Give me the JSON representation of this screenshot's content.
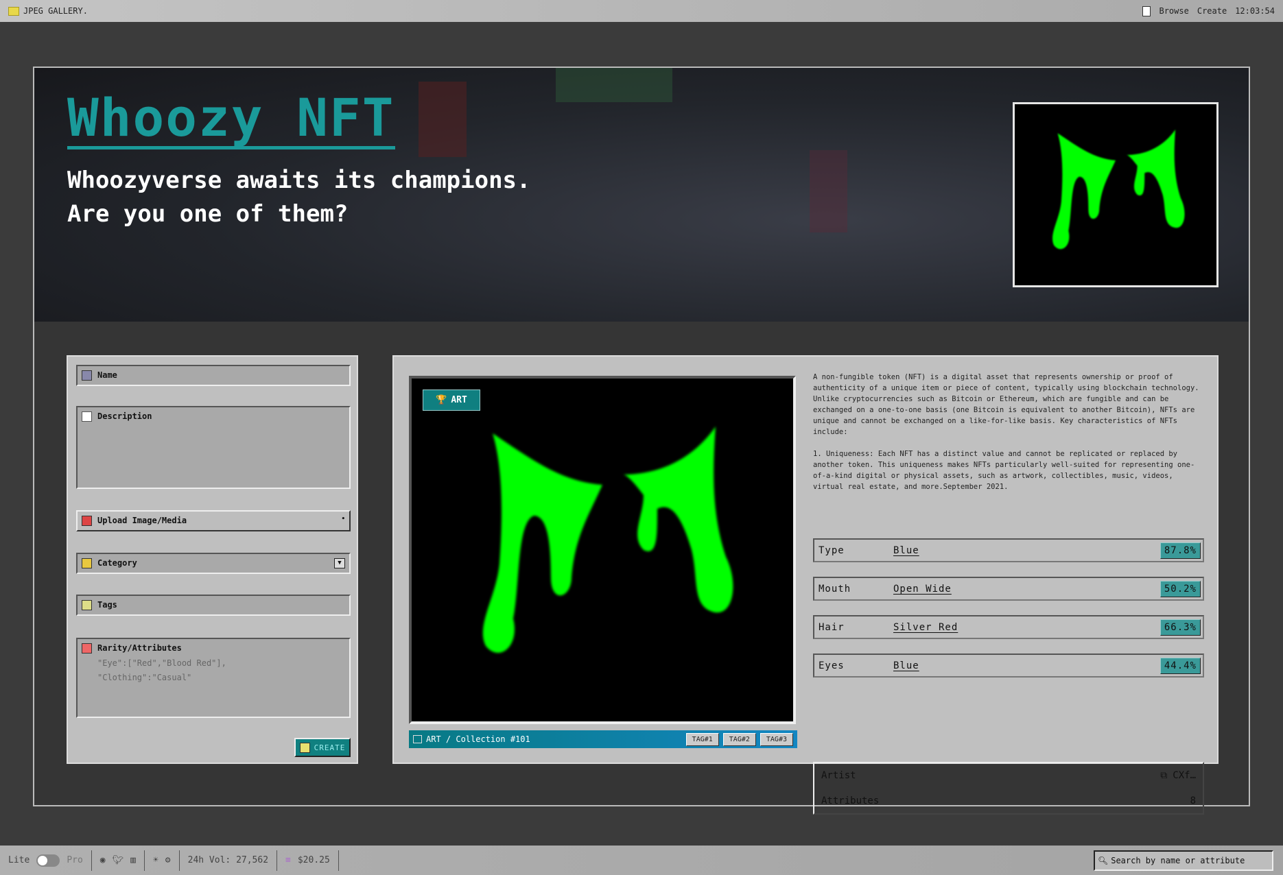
{
  "topbar": {
    "app_title": "JPEG GALLERY.",
    "nav": [
      "Browse",
      "Create"
    ],
    "clock": "12:03:54"
  },
  "hero": {
    "title": "Whoozy NFT",
    "subtitle_line1": "Whoozyverse awaits its champions.",
    "subtitle_line2": "Are you one of them?"
  },
  "form": {
    "name": "Name",
    "description": "Description",
    "upload": "Upload Image/Media",
    "upload_marker": "•",
    "category": "Category",
    "tags": "Tags",
    "rarity": "Rarity/Attributes",
    "rarity_placeholder_line1": "\"Eye\":[\"Red\",\"Blood Red\"],",
    "rarity_placeholder_line2": "\"Clothing\":\"Casual\"",
    "create_label": "CREATE"
  },
  "preview": {
    "badge": "ART",
    "caption": "ART / Collection #101",
    "tags": [
      "TAG#1",
      "TAG#2",
      "TAG#3"
    ]
  },
  "description": {
    "para1": "A non-fungible token (NFT) is a digital asset that represents ownership or proof of authenticity of a unique item or piece of content, typically using blockchain technology. Unlike cryptocurrencies such as Bitcoin or Ethereum, which are fungible and can be exchanged on a one-to-one basis (one Bitcoin is equivalent to another Bitcoin), NFTs are unique and cannot be exchanged on a like-for-like basis. Key characteristics of NFTs include:",
    "para2": "1. Uniqueness: Each NFT has a distinct value and cannot be replicated or replaced by another token. This uniqueness makes NFTs particularly well-suited for representing one-of-a-kind digital or physical assets, such as artwork, collectibles, music, videos, virtual real estate, and more.September 2021."
  },
  "attributes": [
    {
      "key": "Type",
      "value": "Blue",
      "rarity": "87.8%"
    },
    {
      "key": "Mouth",
      "value": "Open Wide",
      "rarity": "50.2%"
    },
    {
      "key": "Hair",
      "value": "Silver Red",
      "rarity": "66.3%"
    },
    {
      "key": "Eyes",
      "value": "Blue",
      "rarity": "44.4%"
    }
  ],
  "artist": {
    "label": "Artist",
    "value": "CXf…",
    "attributes_label": "Attributes",
    "attributes_count": "8"
  },
  "bottombar": {
    "lite": "Lite",
    "pro": "Pro",
    "volume": "24h Vol: 27,562",
    "price": "$20.25",
    "search_placeholder": "Search by name or attribute"
  },
  "colors": {
    "accent": "#1a9a9a",
    "slime": "#00ff00",
    "badge": "#0f7f80"
  }
}
